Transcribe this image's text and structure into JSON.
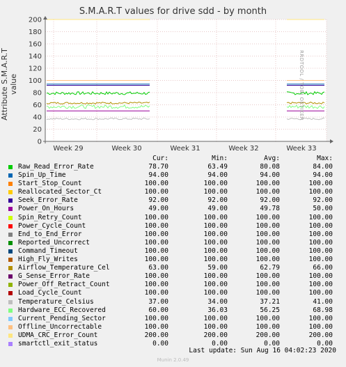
{
  "chart_data": {
    "type": "line",
    "title": "S.M.A.R.T values for drive sdd - by month",
    "ylabel": "Attribute S.M.A.R.T value",
    "ylim": [
      0,
      200
    ],
    "yticks": [
      0,
      20,
      40,
      60,
      80,
      100,
      120,
      140,
      160,
      180,
      200
    ],
    "xtick_labels": [
      "Week 29",
      "Week 30",
      "Week 31",
      "Week 32",
      "Week 33"
    ],
    "grid": true,
    "side_label": "RRDTOOL / TOBI OETIKER",
    "columns": [
      "Cur:",
      "Min:",
      "Avg:",
      "Max:"
    ],
    "series": [
      {
        "name": "Raw_Read_Error_Rate",
        "color": "#00cc00",
        "cur": "78.70",
        "min": "63.49",
        "avg": "80.08",
        "max": "84.00",
        "level": 79,
        "noise": 2.5
      },
      {
        "name": "Spin_Up_Time",
        "color": "#0066b3",
        "cur": "94.00",
        "min": "94.00",
        "avg": "94.00",
        "max": "94.00",
        "level": 94,
        "noise": 0
      },
      {
        "name": "Start_Stop_Count",
        "color": "#ff8000",
        "cur": "100.00",
        "min": "100.00",
        "avg": "100.00",
        "max": "100.00",
        "level": 100,
        "noise": 0
      },
      {
        "name": "Reallocated_Sector_Ct",
        "color": "#ffcc00",
        "cur": "100.00",
        "min": "100.00",
        "avg": "100.00",
        "max": "100.00",
        "level": 100,
        "noise": 0
      },
      {
        "name": "Seek_Error_Rate",
        "color": "#330099",
        "cur": "92.00",
        "min": "92.00",
        "avg": "92.00",
        "max": "92.00",
        "level": 92,
        "noise": 0
      },
      {
        "name": "Power_On_Hours",
        "color": "#990099",
        "cur": "49.00",
        "min": "49.00",
        "avg": "49.78",
        "max": "50.00",
        "level": 50,
        "noise": 0
      },
      {
        "name": "Spin_Retry_Count",
        "color": "#ccff00",
        "cur": "100.00",
        "min": "100.00",
        "avg": "100.00",
        "max": "100.00",
        "level": 100,
        "noise": 0
      },
      {
        "name": "Power_Cycle_Count",
        "color": "#ff0000",
        "cur": "100.00",
        "min": "100.00",
        "avg": "100.00",
        "max": "100.00",
        "level": 100,
        "noise": 0
      },
      {
        "name": "End_to_End_Error",
        "color": "#808080",
        "cur": "100.00",
        "min": "100.00",
        "avg": "100.00",
        "max": "100.00",
        "level": 100,
        "noise": 0
      },
      {
        "name": "Reported_Uncorrect",
        "color": "#008f00",
        "cur": "100.00",
        "min": "100.00",
        "avg": "100.00",
        "max": "100.00",
        "level": 100,
        "noise": 0
      },
      {
        "name": "Command_Timeout",
        "color": "#00487d",
        "cur": "100.00",
        "min": "100.00",
        "avg": "100.00",
        "max": "100.00",
        "level": 100,
        "noise": 0
      },
      {
        "name": "High_Fly_Writes",
        "color": "#b35a00",
        "cur": "100.00",
        "min": "100.00",
        "avg": "100.00",
        "max": "100.00",
        "level": 100,
        "noise": 0
      },
      {
        "name": "Airflow_Temperature_Cel",
        "color": "#b38f00",
        "cur": "63.00",
        "min": "59.00",
        "avg": "62.79",
        "max": "66.00",
        "level": 63,
        "noise": 1.5
      },
      {
        "name": "G_Sense_Error_Rate",
        "color": "#6b006b",
        "cur": "100.00",
        "min": "100.00",
        "avg": "100.00",
        "max": "100.00",
        "level": 100,
        "noise": 0
      },
      {
        "name": "Power_Off_Retract_Count",
        "color": "#8fb300",
        "cur": "100.00",
        "min": "100.00",
        "avg": "100.00",
        "max": "100.00",
        "level": 100,
        "noise": 0
      },
      {
        "name": "Load_Cycle_Count",
        "color": "#b30000",
        "cur": "100.00",
        "min": "100.00",
        "avg": "100.00",
        "max": "100.00",
        "level": 100,
        "noise": 0
      },
      {
        "name": "Temperature_Celsius",
        "color": "#bebebe",
        "cur": "37.00",
        "min": "34.00",
        "avg": "37.21",
        "max": "41.00",
        "level": 37,
        "noise": 1.5
      },
      {
        "name": "Hardware_ECC_Recovered",
        "color": "#80ff80",
        "cur": "60.00",
        "min": "36.03",
        "avg": "56.25",
        "max": "68.98",
        "level": 57,
        "noise": 3
      },
      {
        "name": "Current_Pending_Sector",
        "color": "#80c9ff",
        "cur": "100.00",
        "min": "100.00",
        "avg": "100.00",
        "max": "100.00",
        "level": 100,
        "noise": 0
      },
      {
        "name": "Offline_Uncorrectable",
        "color": "#ffc080",
        "cur": "100.00",
        "min": "100.00",
        "avg": "100.00",
        "max": "100.00",
        "level": 100,
        "noise": 0
      },
      {
        "name": "UDMA_CRC_Error_Count",
        "color": "#ffe680",
        "cur": "200.00",
        "min": "200.00",
        "avg": "200.00",
        "max": "200.00",
        "level": 200,
        "noise": 0
      },
      {
        "name": "smartctl_exit_status",
        "color": "#aa80ff",
        "cur": "0.00",
        "min": "0.00",
        "avg": "0.00",
        "max": "0.00",
        "level": 0,
        "noise": 0
      }
    ],
    "last_update": "Last update: Sun Aug 16 04:02:23 2020",
    "footer": "Munin 2.0.49"
  }
}
